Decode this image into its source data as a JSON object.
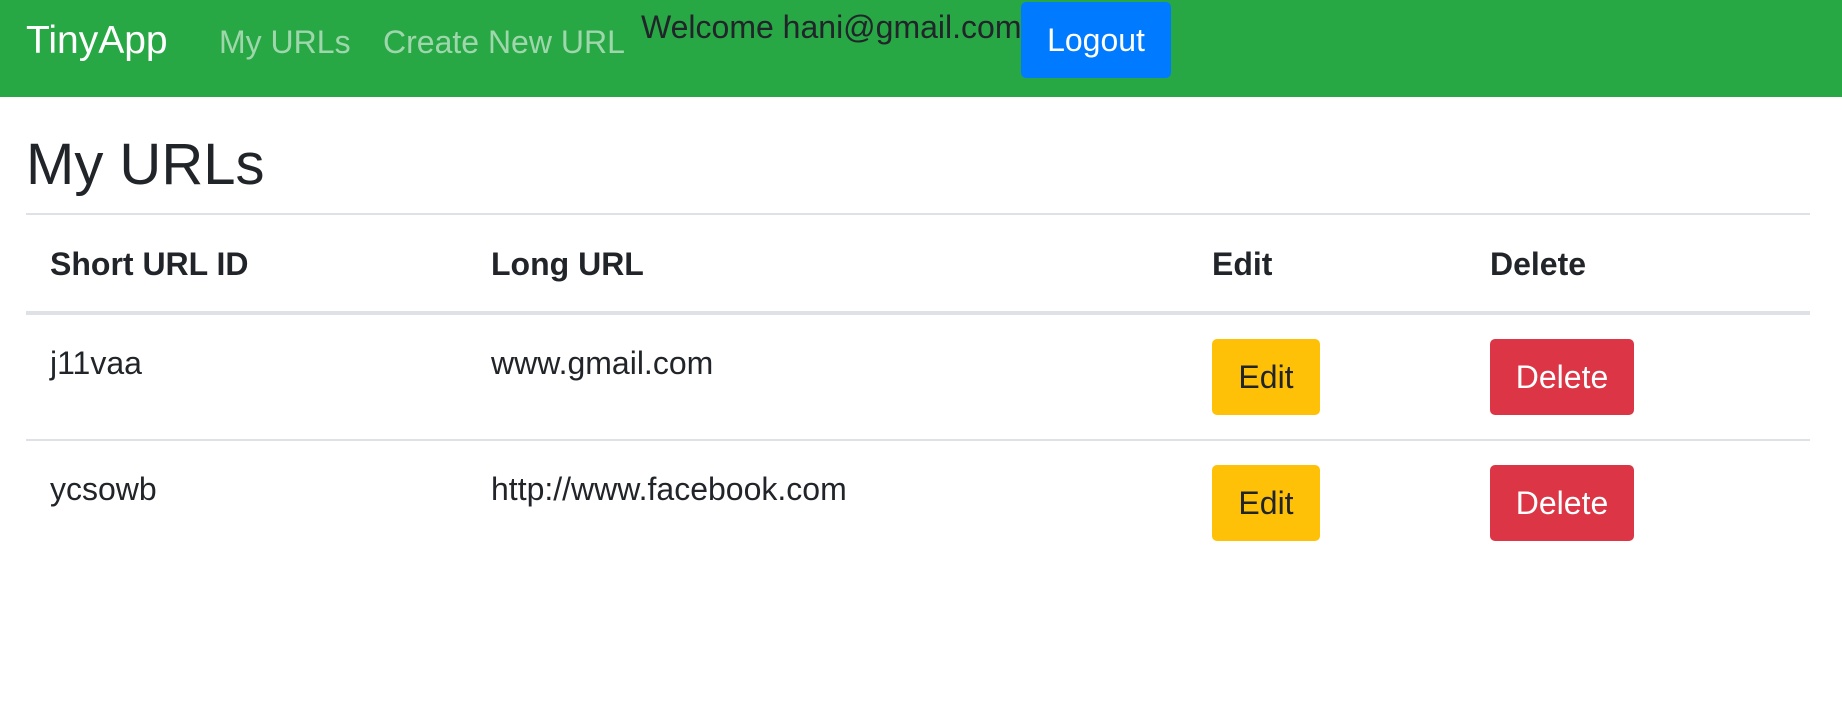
{
  "navbar": {
    "brand": "TinyApp",
    "links": [
      "My URLs",
      "Create New URL"
    ],
    "welcome": "Welcome hani@gmail.com",
    "logout_label": "Logout"
  },
  "page": {
    "title": "My URLs"
  },
  "table": {
    "headers": [
      "Short URL ID",
      "Long URL",
      "Edit",
      "Delete"
    ],
    "rows": [
      {
        "short_id": "j11vaa",
        "long_url": "www.gmail.com",
        "edit_label": "Edit",
        "delete_label": "Delete"
      },
      {
        "short_id": "ycsowb",
        "long_url": "http://www.facebook.com",
        "edit_label": "Edit",
        "delete_label": "Delete"
      }
    ]
  },
  "colors": {
    "navbar": "#28a745",
    "logout": "#007bff",
    "edit": "#ffc107",
    "delete": "#dc3545"
  }
}
